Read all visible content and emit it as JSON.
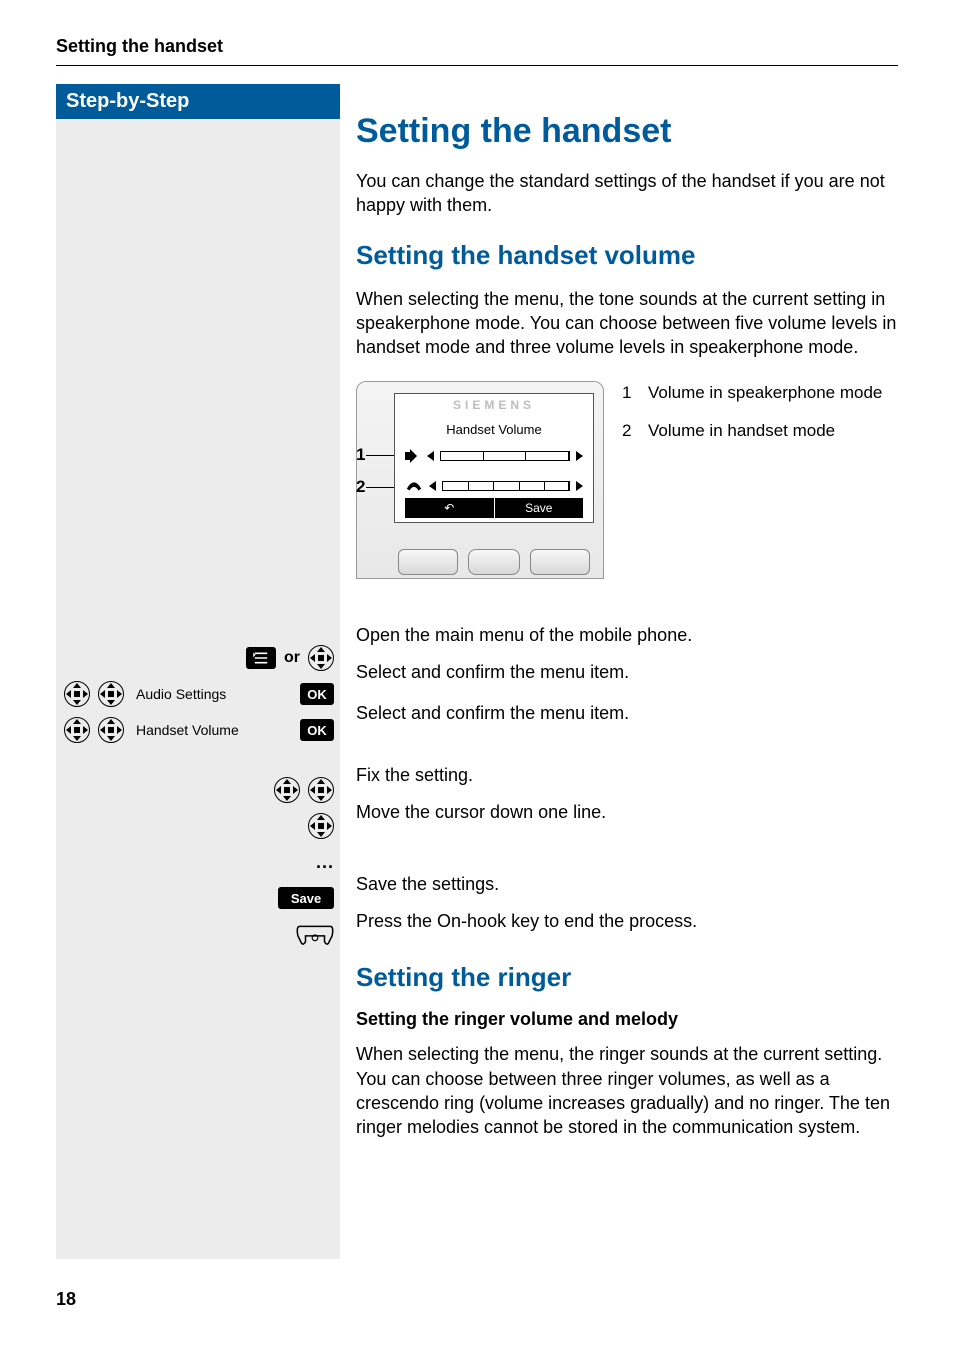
{
  "header": {
    "running": "Setting the handset"
  },
  "sidebar": {
    "title": "Step-by-Step",
    "or": "or",
    "audio_settings": "Audio Settings",
    "handset_volume": "Handset Volume",
    "ok": "OK",
    "save": "Save",
    "dots": "..."
  },
  "main": {
    "h1": "Setting the handset",
    "intro": "You can change the standard settings of the handset if you are not happy with them.",
    "h2_volume": "Setting the handset volume",
    "volume_intro": "When selecting the menu, the tone sounds at the current setting in speakerphone mode. You can choose between five volume levels in handset mode and three volume levels in speakerphone mode.",
    "device": {
      "brand": "SIEMENS",
      "screen_title": "Handset Volume",
      "callout1": "1",
      "callout2": "2",
      "soft_left": "↶",
      "soft_right": "Save"
    },
    "legend": {
      "n1": "1",
      "t1": "Volume in speakerphone mode",
      "n2": "2",
      "t2": "Volume in handset mode"
    },
    "steps": {
      "s1": "Open the main menu of the mobile phone.",
      "s2": "Select and confirm the menu item.",
      "s3": "Select and confirm the menu item.",
      "s4": "Fix the setting.",
      "s5": "Move the cursor down one line.",
      "s6": "Save the settings.",
      "s7": "Press the On-hook key to end the process."
    },
    "h2_ringer": "Setting the ringer",
    "h3_ringer": "Setting the ringer volume and melody",
    "ringer_intro": "When selecting the menu, the ringer sounds at the current setting. You can choose between three ringer volumes, as well as a crescendo ring (volume increases gradually) and no ringer. The ten ringer melodies cannot be stored in the communication system."
  },
  "footer": {
    "page": "18"
  }
}
